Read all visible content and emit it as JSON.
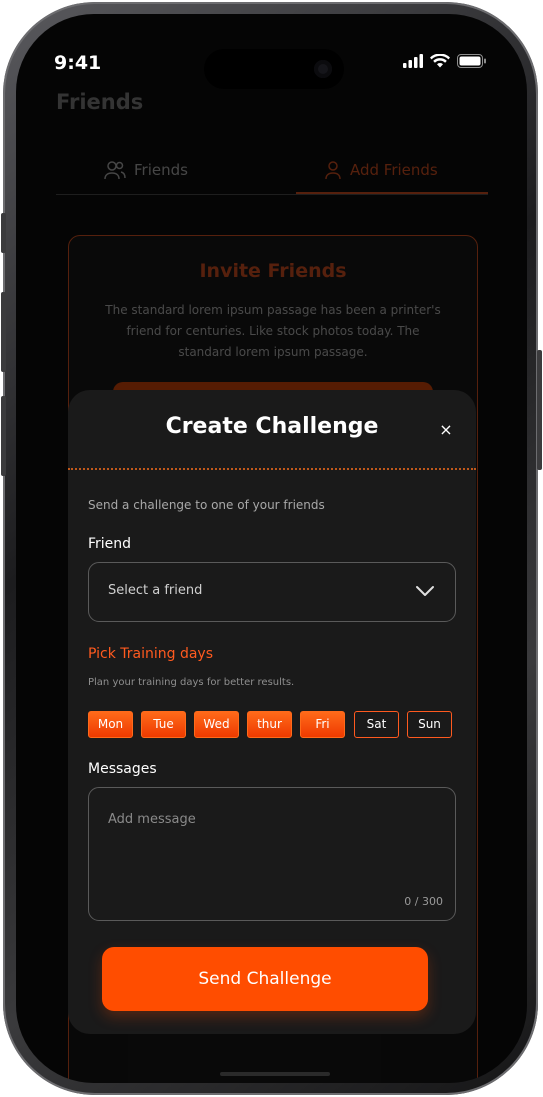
{
  "status_bar": {
    "time": "9:41"
  },
  "background": {
    "title": "Friends",
    "tabs": [
      {
        "label": "Friends",
        "icon": "users-icon"
      },
      {
        "label": "Add Friends",
        "icon": "add-user-icon",
        "active": true
      }
    ],
    "invite_card": {
      "title": "Invite Friends",
      "description": "The standard lorem ipsum passage has been a printer's friend for centuries. Like stock photos today. The standard lorem ipsum passage."
    }
  },
  "modal": {
    "title": "Create Challenge",
    "close_label": "×",
    "subtitle": "Send a challenge to one of your friends",
    "friend_label": "Friend",
    "friend_placeholder": "Select a friend",
    "training_title": "Pick Training days",
    "training_subtitle": "Plan your training days for better results.",
    "days": [
      {
        "label": "Mon",
        "selected": true
      },
      {
        "label": "Tue",
        "selected": true
      },
      {
        "label": "Wed",
        "selected": true
      },
      {
        "label": "thur",
        "selected": true
      },
      {
        "label": "Fri",
        "selected": true
      },
      {
        "label": "Sat",
        "selected": false
      },
      {
        "label": "Sun",
        "selected": false
      }
    ],
    "messages_label": "Messages",
    "message_placeholder": "Add message",
    "char_count": "0 / 300",
    "send_label": "Send Challenge"
  },
  "colors": {
    "accent": "#ff4d00",
    "accent_text": "#ff5a1f",
    "modal_bg": "#1a1a1a",
    "screen_bg": "#050505"
  }
}
